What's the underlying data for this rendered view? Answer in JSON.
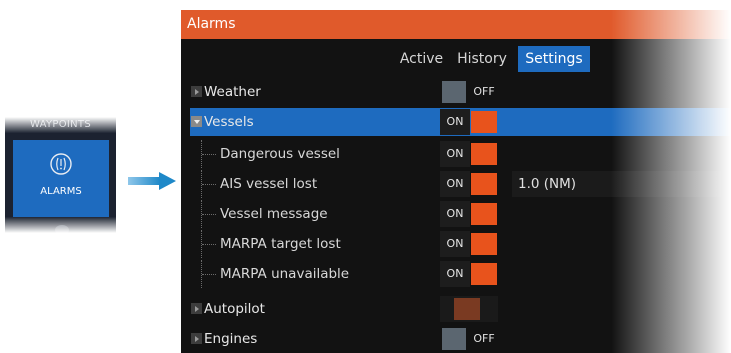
{
  "tile": {
    "top_label": "WAYPOINTS",
    "label": "ALARMS",
    "icon": "alarm-icon"
  },
  "window": {
    "title": "Alarms"
  },
  "tabs": [
    {
      "label": "Active"
    },
    {
      "label": "History"
    },
    {
      "label": "Settings"
    }
  ],
  "rows": [
    {
      "label": "Weather",
      "state": "OFF"
    },
    {
      "label": "Vessels",
      "state": "ON"
    },
    {
      "label": "Dangerous vessel",
      "state": "ON"
    },
    {
      "label": "AIS vessel lost",
      "state": "ON",
      "value": "1.0 (NM)"
    },
    {
      "label": "Vessel message",
      "state": "ON"
    },
    {
      "label": "MARPA target lost",
      "state": "ON"
    },
    {
      "label": "MARPA unavailable",
      "state": "ON"
    },
    {
      "label": "Autopilot",
      "state": ""
    },
    {
      "label": "Engines",
      "state": "OFF"
    }
  ],
  "colors": {
    "accent": "#e05a2b",
    "selection": "#1e6bbf",
    "toggle_on": "#e8531c",
    "toggle_off": "#5b6670"
  }
}
